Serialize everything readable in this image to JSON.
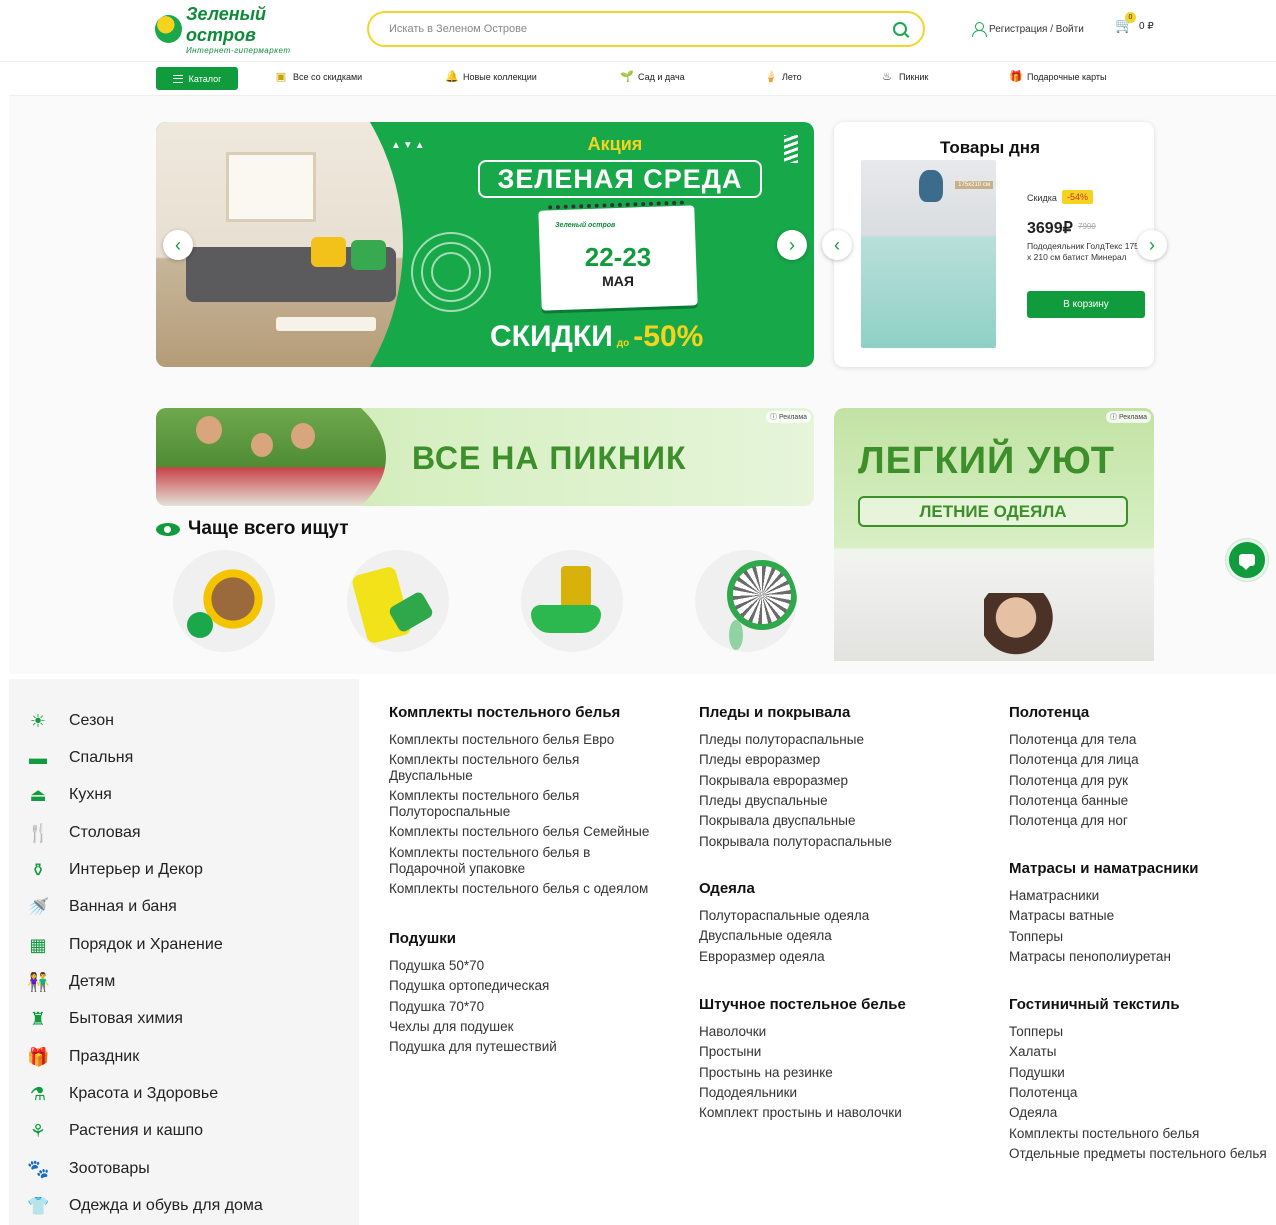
{
  "header": {
    "logo_title": "Зеленый остров",
    "logo_subtitle": "Интернет-гипермаркет",
    "search_placeholder": "Искать в Зеленом Острове",
    "login_label": "Регистрация / Войти",
    "cart_count": "0",
    "cart_total": "0 ₽"
  },
  "nav": {
    "catalog_label": "Каталог",
    "items": [
      {
        "label": "Все со скидками",
        "icon": "percent-tag-icon"
      },
      {
        "label": "Новые коллекции",
        "icon": "bell-icon"
      },
      {
        "label": "Сад и дача",
        "icon": "plant-icon"
      },
      {
        "label": "Лето",
        "icon": "ice-cream-icon"
      },
      {
        "label": "Пикник",
        "icon": "grill-icon"
      },
      {
        "label": "Подарочные карты",
        "icon": "gift-card-icon"
      }
    ]
  },
  "main_banner": {
    "tag": "Акция",
    "title": "ЗЕЛЕНАЯ СРЕДА",
    "calendar_brand": "Зеленый остров",
    "calendar_days": "22-23",
    "calendar_month": "МАЯ",
    "sale_text": "СКИДКИ",
    "sale_prefix": "до",
    "sale_value": "-50%"
  },
  "deals": {
    "title": "Товары дня",
    "image_size_label": "175x210 см",
    "discount_label": "Скидка",
    "discount_value": "-54%",
    "price": "3699₽",
    "old_price": "7999",
    "product_name": "Пододеяльник ГолдТекс 175 х 210 см батист Минерал",
    "button_label": "В корзину"
  },
  "picnic_banner": {
    "title": "ВСЕ НА ПИКНИК",
    "ad_label": "ⓘ Реклама"
  },
  "cozy_banner": {
    "title": "ЛЕГКИЙ УЮТ",
    "subtitle": "ЛЕТНИЕ ОДЕЯЛА",
    "ad_label": "ⓘ Реклама"
  },
  "often_searched": {
    "title": "Чаще всего ищут"
  },
  "sidebar": {
    "items": [
      {
        "label": "Сезон",
        "icon": "sun-icon"
      },
      {
        "label": "Спальня",
        "icon": "bed-icon"
      },
      {
        "label": "Кухня",
        "icon": "pot-icon"
      },
      {
        "label": "Столовая",
        "icon": "cutlery-icon"
      },
      {
        "label": "Интерьер и Декор",
        "icon": "vase-icon"
      },
      {
        "label": "Ванная и баня",
        "icon": "shower-icon"
      },
      {
        "label": "Порядок и Хранение",
        "icon": "shelf-icon"
      },
      {
        "label": "Детям",
        "icon": "children-icon"
      },
      {
        "label": "Бытовая химия",
        "icon": "spray-icon"
      },
      {
        "label": "Праздник",
        "icon": "gift-icon"
      },
      {
        "label": "Красота и Здоровье",
        "icon": "beauty-icon"
      },
      {
        "label": "Растения и кашпо",
        "icon": "flowerpot-icon"
      },
      {
        "label": "Зоотовары",
        "icon": "paw-icon"
      },
      {
        "label": "Одежда и обувь для дома",
        "icon": "tshirt-icon"
      }
    ]
  },
  "menu": {
    "col1": {
      "group1": {
        "title": "Комплекты постельного белья",
        "links": [
          "Комплекты постельного белья Евро",
          "Комплекты постельного белья|Двуспальные",
          "Комплекты постельного белья|Полуторoспальные",
          "Комплекты постельного белья Семейные",
          "Комплекты постельного белья в|Подарочной упаковке",
          "Комплекты постельного белья с одеялом"
        ]
      },
      "group2": {
        "title": "Подушки",
        "links": [
          "Подушка 50*70",
          "Подушка ортопедическая",
          "Подушка 70*70",
          "Чехлы для подушек",
          "Подушка для путешествий"
        ]
      }
    },
    "col2": {
      "group1": {
        "title": "Пледы и покрывала",
        "links": [
          "Пледы полутораспальные",
          "Пледы евроразмер",
          "Покрывала евроразмер",
          "Пледы двуспальные",
          "Покрывала двуспальные",
          "Покрывала полутораспальные"
        ]
      },
      "group2": {
        "title": "Одеяла",
        "links": [
          "Полутораспальные одеяла",
          "Двуспальные одеяла",
          "Евроразмер одеяла"
        ]
      },
      "group3": {
        "title": "Штучное постельное белье",
        "links": [
          "Наволочки",
          "Простыни",
          "Простынь на резинке",
          "Пододеяльники",
          "Комплект простынь и наволочки"
        ]
      }
    },
    "col3": {
      "group1": {
        "title": "Полотенца",
        "links": [
          "Полотенца для тела",
          "Полотенца для лица",
          "Полотенца для рук",
          "Полотенца банные",
          "Полотенца для ног"
        ]
      },
      "group2": {
        "title": "Матрасы и наматрасники",
        "links": [
          "Наматрасники",
          "Матрасы ватные",
          "Топперы",
          "Матрасы пенополиуретан"
        ]
      },
      "group3": {
        "title": "Гостиничный текстиль",
        "links": [
          "Топперы",
          "Халаты",
          "Подушки",
          "Полотенца",
          "Одеяла",
          "Комплекты постельного белья",
          "Отдельные предметы постельного белья"
        ]
      }
    }
  },
  "colors": {
    "brand_green": "#109b3d",
    "accent_yellow": "#f5d31e"
  }
}
